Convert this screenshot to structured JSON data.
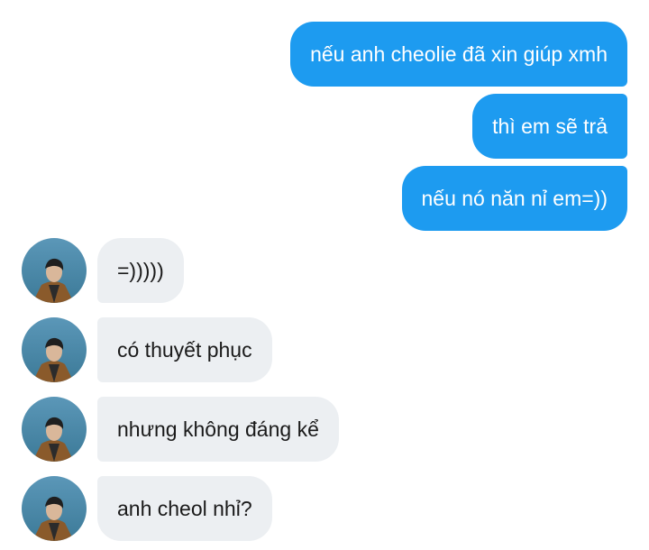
{
  "colors": {
    "outgoing_bubble": "#1d9bf0",
    "incoming_bubble": "#eceff2",
    "outgoing_text": "#ffffff",
    "incoming_text": "#1a1a1a"
  },
  "outgoing": [
    {
      "text": "nếu anh cheolie đã xin giúp xmh"
    },
    {
      "text": "thì em sẽ trả"
    },
    {
      "text": "nếu nó năn nỉ em=))"
    }
  ],
  "incoming": [
    {
      "text": "=)))))",
      "avatar": "user-avatar-icon"
    },
    {
      "text": "có thuyết phục",
      "avatar": "user-avatar-icon"
    },
    {
      "text": "nhưng không đáng kể",
      "avatar": "user-avatar-icon"
    },
    {
      "text": "anh cheol nhỉ?",
      "avatar": "user-avatar-icon"
    }
  ]
}
